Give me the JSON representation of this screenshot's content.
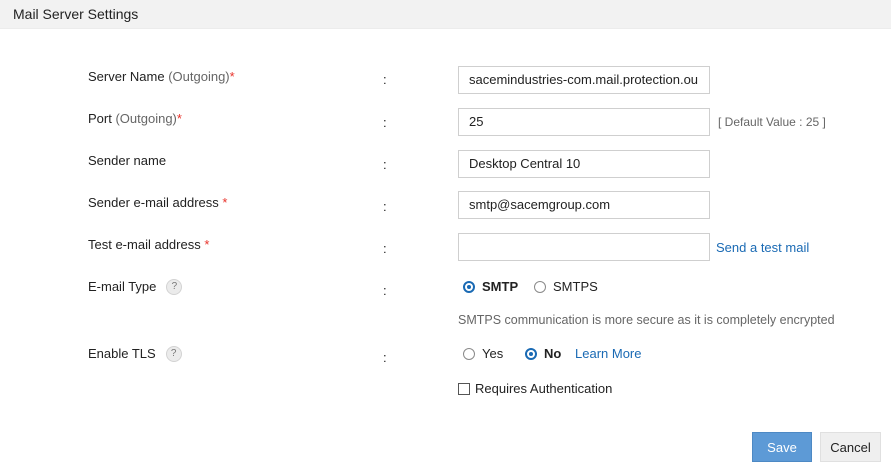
{
  "header": {
    "title": "Mail Server Settings"
  },
  "form": {
    "colon": ":",
    "server_name": {
      "label": "Server Name",
      "hint": "(Outgoing)",
      "required": "*",
      "value": "sacemindustries-com.mail.protection.ou"
    },
    "port": {
      "label": "Port",
      "hint": "(Outgoing)",
      "required": "*",
      "value": "25",
      "default_note": "[ Default Value : 25 ]"
    },
    "sender_name": {
      "label": "Sender name",
      "value": "Desktop Central 10"
    },
    "sender_email": {
      "label": "Sender e-mail address",
      "required": "*",
      "value": "smtp@sacemgroup.com"
    },
    "test_email": {
      "label": "Test e-mail address",
      "required": "*",
      "value": "",
      "link": "Send a test mail"
    },
    "email_type": {
      "label": "E-mail Type",
      "help": "?",
      "options": [
        "SMTP",
        "SMTPS"
      ],
      "selected": "SMTP",
      "note": "SMTPS communication is more secure as it is completely encrypted"
    },
    "enable_tls": {
      "label": "Enable TLS",
      "help": "?",
      "options": [
        "Yes",
        "No"
      ],
      "selected": "No",
      "link": "Learn More"
    },
    "auth": {
      "label": "Requires Authentication",
      "checked": false
    }
  },
  "buttons": {
    "save": "Save",
    "cancel": "Cancel"
  },
  "colors": {
    "accent": "#1a6ab4",
    "save_bg": "#5d9ad6",
    "required": "#e8322a"
  }
}
